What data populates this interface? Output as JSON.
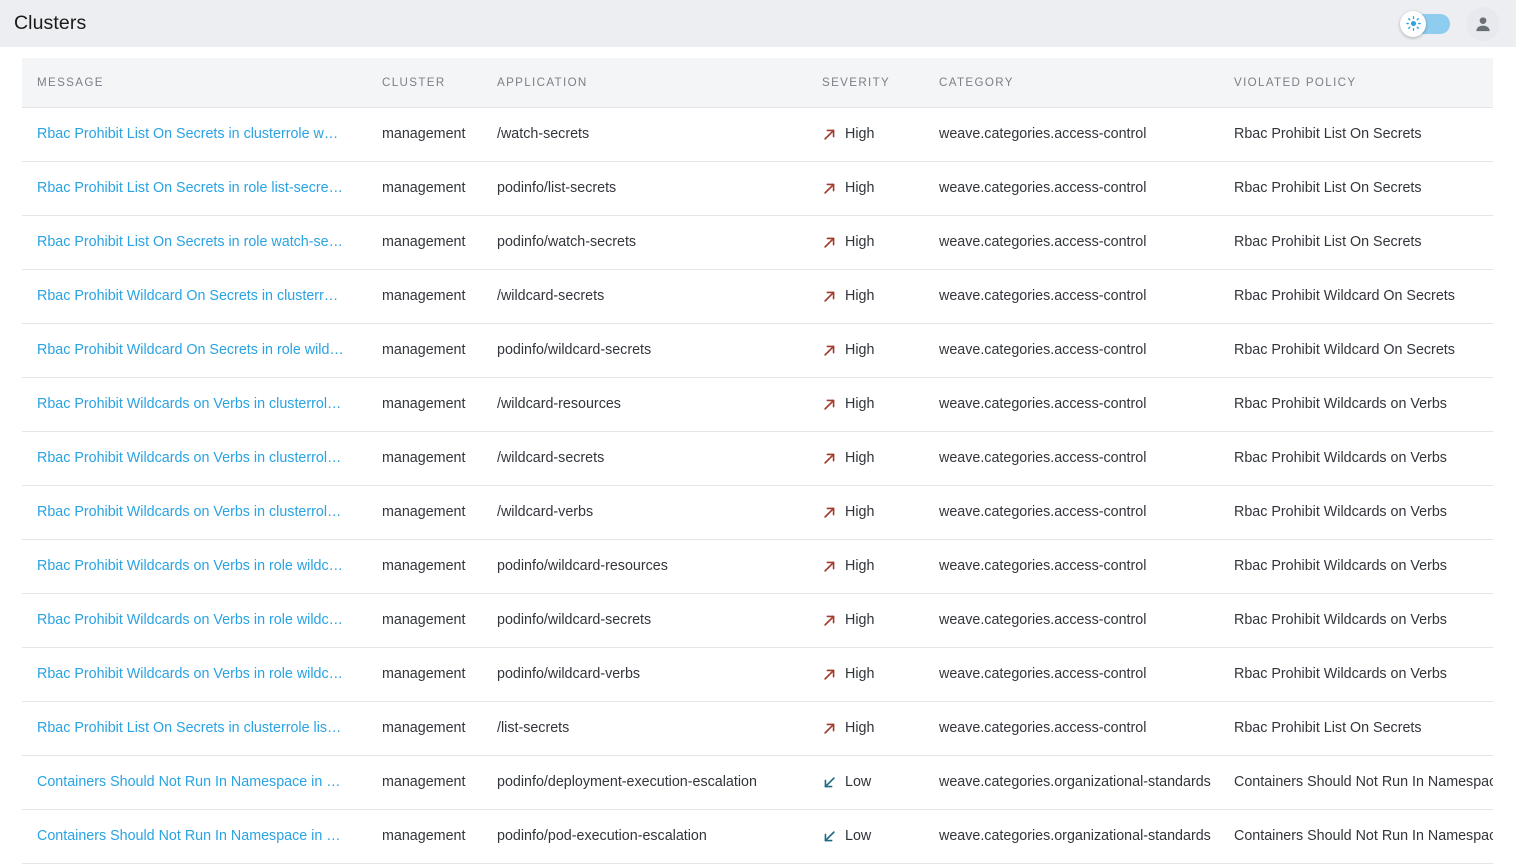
{
  "appbar": {
    "title": "Clusters",
    "theme_toggle": {
      "name": "light-dark-mode-toggle",
      "state": "light",
      "track_color": "#8ecdf0",
      "icon_color": "#29a3e3"
    },
    "account_icon": "user-avatar-icon"
  },
  "colors": {
    "appbar_bg": "#eceef2",
    "table_header_bg": "#f4f5f7",
    "link": "#29a3e3",
    "severity_high": "#a43a2a",
    "severity_low": "#1f6b87",
    "row_border": "#e4e6e8",
    "text": "#32353b",
    "header_text": "#7b7f87"
  },
  "table": {
    "columns": [
      {
        "key": "message",
        "label": "MESSAGE"
      },
      {
        "key": "cluster",
        "label": "CLUSTER"
      },
      {
        "key": "application",
        "label": "APPLICATION"
      },
      {
        "key": "severity",
        "label": "SEVERITY"
      },
      {
        "key": "category",
        "label": "CATEGORY"
      },
      {
        "key": "policy",
        "label": "VIOLATED POLICY"
      }
    ],
    "rows": [
      {
        "message": "Rbac Prohibit List On Secrets in clusterrole wat...",
        "cluster": "management",
        "application": "/watch-secrets",
        "severity": "High",
        "severity_icon": "arrow-up-right-icon",
        "category": "weave.categories.access-control",
        "policy": "Rbac Prohibit List On Secrets"
      },
      {
        "message": "Rbac Prohibit List On Secrets in role list-secrets...",
        "cluster": "management",
        "application": "podinfo/list-secrets",
        "severity": "High",
        "severity_icon": "arrow-up-right-icon",
        "category": "weave.categories.access-control",
        "policy": "Rbac Prohibit List On Secrets"
      },
      {
        "message": "Rbac Prohibit List On Secrets in role watch-secr...",
        "cluster": "management",
        "application": "podinfo/watch-secrets",
        "severity": "High",
        "severity_icon": "arrow-up-right-icon",
        "category": "weave.categories.access-control",
        "policy": "Rbac Prohibit List On Secrets"
      },
      {
        "message": "Rbac Prohibit Wildcard On Secrets in clusterrol...",
        "cluster": "management",
        "application": "/wildcard-secrets",
        "severity": "High",
        "severity_icon": "arrow-up-right-icon",
        "category": "weave.categories.access-control",
        "policy": "Rbac Prohibit Wildcard On Secrets"
      },
      {
        "message": "Rbac Prohibit Wildcard On Secrets in role wildc...",
        "cluster": "management",
        "application": "podinfo/wildcard-secrets",
        "severity": "High",
        "severity_icon": "arrow-up-right-icon",
        "category": "weave.categories.access-control",
        "policy": "Rbac Prohibit Wildcard On Secrets"
      },
      {
        "message": "Rbac Prohibit Wildcards on Verbs in clusterrole ...",
        "cluster": "management",
        "application": "/wildcard-resources",
        "severity": "High",
        "severity_icon": "arrow-up-right-icon",
        "category": "weave.categories.access-control",
        "policy": "Rbac Prohibit Wildcards on Verbs"
      },
      {
        "message": "Rbac Prohibit Wildcards on Verbs in clusterrole ...",
        "cluster": "management",
        "application": "/wildcard-secrets",
        "severity": "High",
        "severity_icon": "arrow-up-right-icon",
        "category": "weave.categories.access-control",
        "policy": "Rbac Prohibit Wildcards on Verbs"
      },
      {
        "message": "Rbac Prohibit Wildcards on Verbs in clusterrole ...",
        "cluster": "management",
        "application": "/wildcard-verbs",
        "severity": "High",
        "severity_icon": "arrow-up-right-icon",
        "category": "weave.categories.access-control",
        "policy": "Rbac Prohibit Wildcards on Verbs"
      },
      {
        "message": "Rbac Prohibit Wildcards on Verbs in role wildca...",
        "cluster": "management",
        "application": "podinfo/wildcard-resources",
        "severity": "High",
        "severity_icon": "arrow-up-right-icon",
        "category": "weave.categories.access-control",
        "policy": "Rbac Prohibit Wildcards on Verbs"
      },
      {
        "message": "Rbac Prohibit Wildcards on Verbs in role wildca...",
        "cluster": "management",
        "application": "podinfo/wildcard-secrets",
        "severity": "High",
        "severity_icon": "arrow-up-right-icon",
        "category": "weave.categories.access-control",
        "policy": "Rbac Prohibit Wildcards on Verbs"
      },
      {
        "message": "Rbac Prohibit Wildcards on Verbs in role wildca...",
        "cluster": "management",
        "application": "podinfo/wildcard-verbs",
        "severity": "High",
        "severity_icon": "arrow-up-right-icon",
        "category": "weave.categories.access-control",
        "policy": "Rbac Prohibit Wildcards on Verbs"
      },
      {
        "message": "Rbac Prohibit List On Secrets in clusterrole list-...",
        "cluster": "management",
        "application": "/list-secrets",
        "severity": "High",
        "severity_icon": "arrow-up-right-icon",
        "category": "weave.categories.access-control",
        "policy": "Rbac Prohibit List On Secrets"
      },
      {
        "message": "Containers Should Not Run In Namespace in d...",
        "cluster": "management",
        "application": "podinfo/deployment-execution-escalation",
        "severity": "Low",
        "severity_icon": "arrow-down-left-icon",
        "category": "weave.categories.organizational-standards",
        "policy": "Containers Should Not Run In Namespace"
      },
      {
        "message": "Containers Should Not Run In Namespace in p...",
        "cluster": "management",
        "application": "podinfo/pod-execution-escalation",
        "severity": "Low",
        "severity_icon": "arrow-down-left-icon",
        "category": "weave.categories.organizational-standards",
        "policy": "Containers Should Not Run In Namespace"
      }
    ]
  }
}
